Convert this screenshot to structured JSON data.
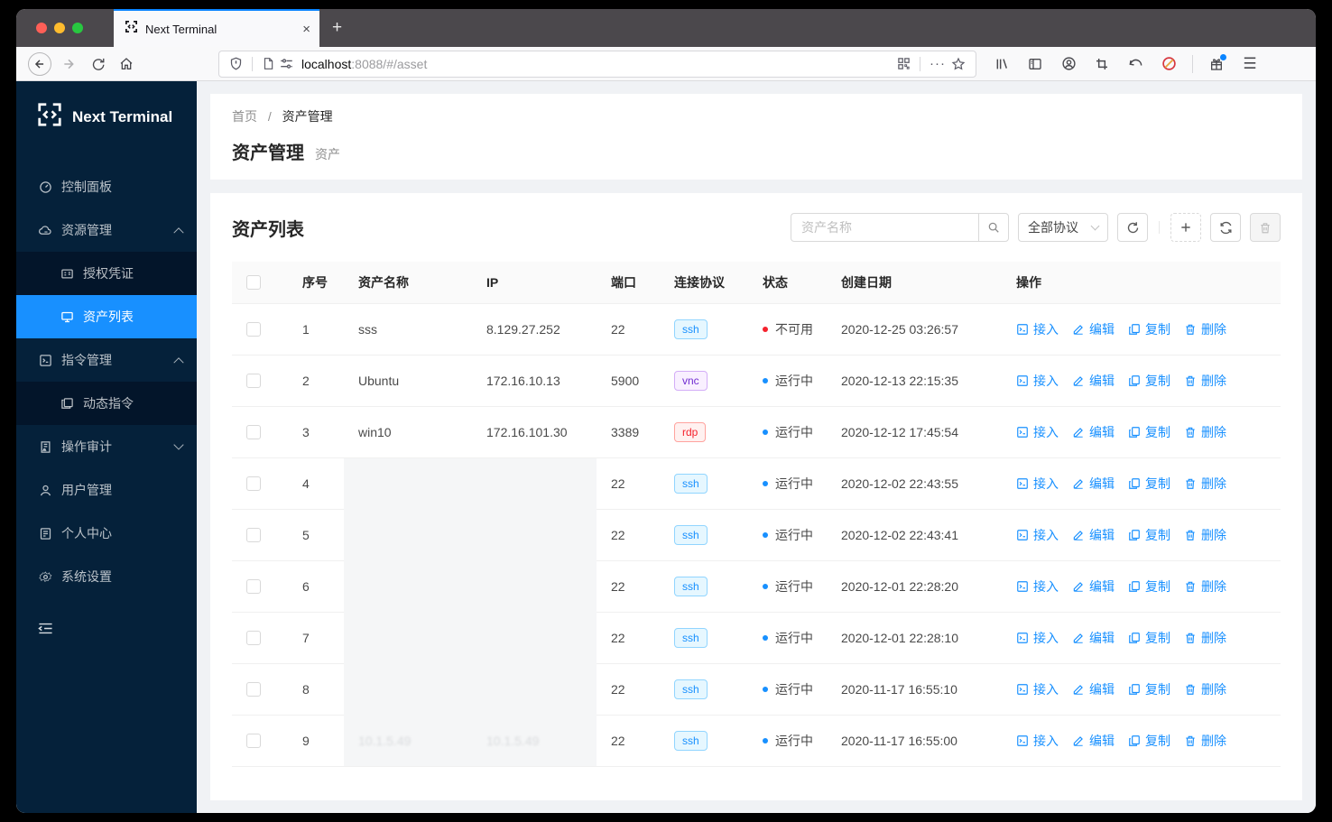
{
  "browser": {
    "tab_title": "Next Terminal",
    "url_host": "localhost",
    "url_path": ":8088/#/asset",
    "urlbar_icons": [
      "shield-icon",
      "page-icon",
      "permissions-icon",
      "qr-code-icon",
      "page-actions-icon",
      "bookmark-star-icon"
    ],
    "toolbar_icons": [
      "library-icon",
      "sidebars-icon",
      "account-icon",
      "screenshot-icon",
      "undo-icon",
      "content-block-icon",
      "gift-icon",
      "menu-icon"
    ]
  },
  "sidebar": {
    "logo_text": "Next Terminal",
    "items": [
      {
        "id": "dashboard",
        "icon": "dashboard-icon",
        "label": "控制面板"
      },
      {
        "id": "resources",
        "icon": "cloud-server-icon",
        "label": "资源管理",
        "caret": "up"
      },
      {
        "id": "credentials",
        "icon": "idcard-icon",
        "label": "授权凭证",
        "submenu": true
      },
      {
        "id": "assets",
        "icon": "desktop-icon",
        "label": "资产列表",
        "submenu": true,
        "active": true
      },
      {
        "id": "commands",
        "icon": "code-icon",
        "label": "指令管理",
        "caret": "up"
      },
      {
        "id": "dynamic-commands",
        "icon": "block-icon",
        "label": "动态指令",
        "submenu": true
      },
      {
        "id": "audit",
        "icon": "audit-icon",
        "label": "操作审计",
        "caret": "down"
      },
      {
        "id": "users",
        "icon": "user-icon",
        "label": "用户管理"
      },
      {
        "id": "profile",
        "icon": "profile-icon",
        "label": "个人中心"
      },
      {
        "id": "settings",
        "icon": "setting-icon",
        "label": "系统设置"
      }
    ]
  },
  "breadcrumb": {
    "home": "首页",
    "sep": "/",
    "current": "资产管理"
  },
  "page": {
    "title": "资产管理",
    "subtitle": "资产"
  },
  "table": {
    "card_title": "资产列表",
    "search_placeholder": "资产名称",
    "protocol_filter_value": "全部协议",
    "columns": [
      "序号",
      "资产名称",
      "IP",
      "端口",
      "连接协议",
      "状态",
      "创建日期",
      "操作"
    ],
    "actions": [
      {
        "id": "access",
        "icon": "terminal-icon",
        "label": "接入"
      },
      {
        "id": "edit",
        "icon": "edit-icon",
        "label": "编辑"
      },
      {
        "id": "copy",
        "icon": "copy-icon",
        "label": "复制"
      },
      {
        "id": "delete",
        "icon": "trash-icon",
        "label": "删除"
      }
    ],
    "rows": [
      {
        "id": "1",
        "name": "sss",
        "ip": "8.129.27.252",
        "port": "22",
        "protocol": "ssh",
        "status_label": "不可用",
        "status_type": "unavailable",
        "created": "2020-12-25 03:26:57"
      },
      {
        "id": "2",
        "name": "Ubuntu",
        "ip": "172.16.10.13",
        "port": "5900",
        "protocol": "vnc",
        "status_label": "运行中",
        "status_type": "running",
        "created": "2020-12-13 22:15:35"
      },
      {
        "id": "3",
        "name": "win10",
        "ip": "172.16.101.30",
        "port": "3389",
        "protocol": "rdp",
        "status_label": "运行中",
        "status_type": "running",
        "created": "2020-12-12 17:45:54"
      },
      {
        "id": "4",
        "name": "",
        "ip": "",
        "port": "22",
        "protocol": "ssh",
        "status_label": "运行中",
        "status_type": "running",
        "created": "2020-12-02 22:43:55",
        "masked": true
      },
      {
        "id": "5",
        "name": "",
        "ip": "",
        "port": "22",
        "protocol": "ssh",
        "status_label": "运行中",
        "status_type": "running",
        "created": "2020-12-02 22:43:41",
        "masked": true
      },
      {
        "id": "6",
        "name": "",
        "ip": "",
        "port": "22",
        "protocol": "ssh",
        "status_label": "运行中",
        "status_type": "running",
        "created": "2020-12-01 22:28:20",
        "masked": true
      },
      {
        "id": "7",
        "name": "",
        "ip": "",
        "port": "22",
        "protocol": "ssh",
        "status_label": "运行中",
        "status_type": "running",
        "created": "2020-12-01 22:28:10",
        "masked": true
      },
      {
        "id": "8",
        "name": "",
        "ip": "",
        "port": "22",
        "protocol": "ssh",
        "status_label": "运行中",
        "status_type": "running",
        "created": "2020-11-17 16:55:10",
        "masked": true
      },
      {
        "id": "9",
        "name": "10.1.5.49",
        "ip": "10.1.5.49",
        "port": "22",
        "protocol": "ssh",
        "status_label": "运行中",
        "status_type": "running",
        "created": "2020-11-17 16:55:00",
        "masked": true,
        "masked_faint": true
      }
    ]
  },
  "colors": {
    "accent": "#1890ff",
    "sidebar_bg": "#05213a",
    "sidebar_submenu_bg": "#03152a",
    "tab_accent": "#0a84ff",
    "status": {
      "running": "#1890ff",
      "unavailable": "#f5222d"
    },
    "protocols": {
      "ssh": {
        "bg": "#e6f7ff",
        "border": "#91d5ff",
        "text": "#1890ff"
      },
      "vnc": {
        "bg": "#f9f0ff",
        "border": "#d3adf7",
        "text": "#722ed1"
      },
      "rdp": {
        "bg": "#fff1f0",
        "border": "#ffa39e",
        "text": "#f5222d"
      }
    }
  }
}
